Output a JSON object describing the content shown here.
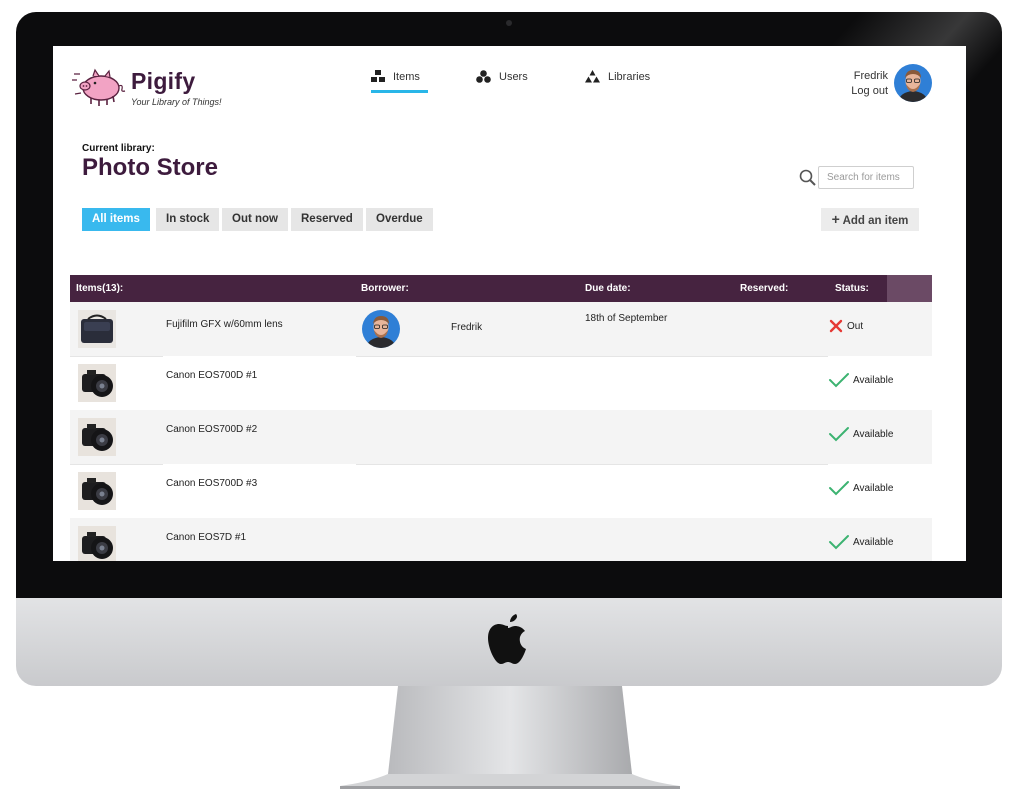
{
  "brand": {
    "name": "Pigify",
    "tagline": "Your Library of Things!"
  },
  "nav": [
    {
      "label": "Items",
      "icon": "items-icon",
      "active": true
    },
    {
      "label": "Users",
      "icon": "users-icon",
      "active": false
    },
    {
      "label": "Libraries",
      "icon": "libraries-icon",
      "active": false
    }
  ],
  "user": {
    "name": "Fredrik",
    "logout_label": "Log out"
  },
  "library": {
    "label": "Current library:",
    "name": "Photo Store"
  },
  "search": {
    "placeholder": "Search for items"
  },
  "filters": [
    "All items",
    "In stock",
    "Out now",
    "Reserved",
    "Overdue"
  ],
  "active_filter": "All items",
  "add_button": "Add an item",
  "table": {
    "headers": {
      "items": "Items(13):",
      "borrower": "Borrower:",
      "due": "Due date:",
      "reserved": "Reserved:",
      "status": "Status:"
    },
    "rows": [
      {
        "name": "Fujifilm GFX w/60mm lens",
        "borrower": "Fredrik",
        "due": "18th of September",
        "reserved": "",
        "status": "Out",
        "status_icon": "cross-icon"
      },
      {
        "name": "Canon EOS700D #1",
        "borrower": "",
        "due": "",
        "reserved": "",
        "status": "Available",
        "status_icon": "check-icon"
      },
      {
        "name": "Canon EOS700D #2",
        "borrower": "",
        "due": "",
        "reserved": "",
        "status": "Available",
        "status_icon": "check-icon"
      },
      {
        "name": "Canon EOS700D #3",
        "borrower": "",
        "due": "",
        "reserved": "",
        "status": "Available",
        "status_icon": "check-icon"
      },
      {
        "name": "Canon EOS7D #1",
        "borrower": "",
        "due": "",
        "reserved": "",
        "status": "Available",
        "status_icon": "check-icon"
      }
    ]
  },
  "colors": {
    "brand": "#3d1b3d",
    "header_bar": "#462340",
    "accent": "#39b9ee",
    "status_out": "#e53935",
    "status_available": "#3cb371"
  }
}
